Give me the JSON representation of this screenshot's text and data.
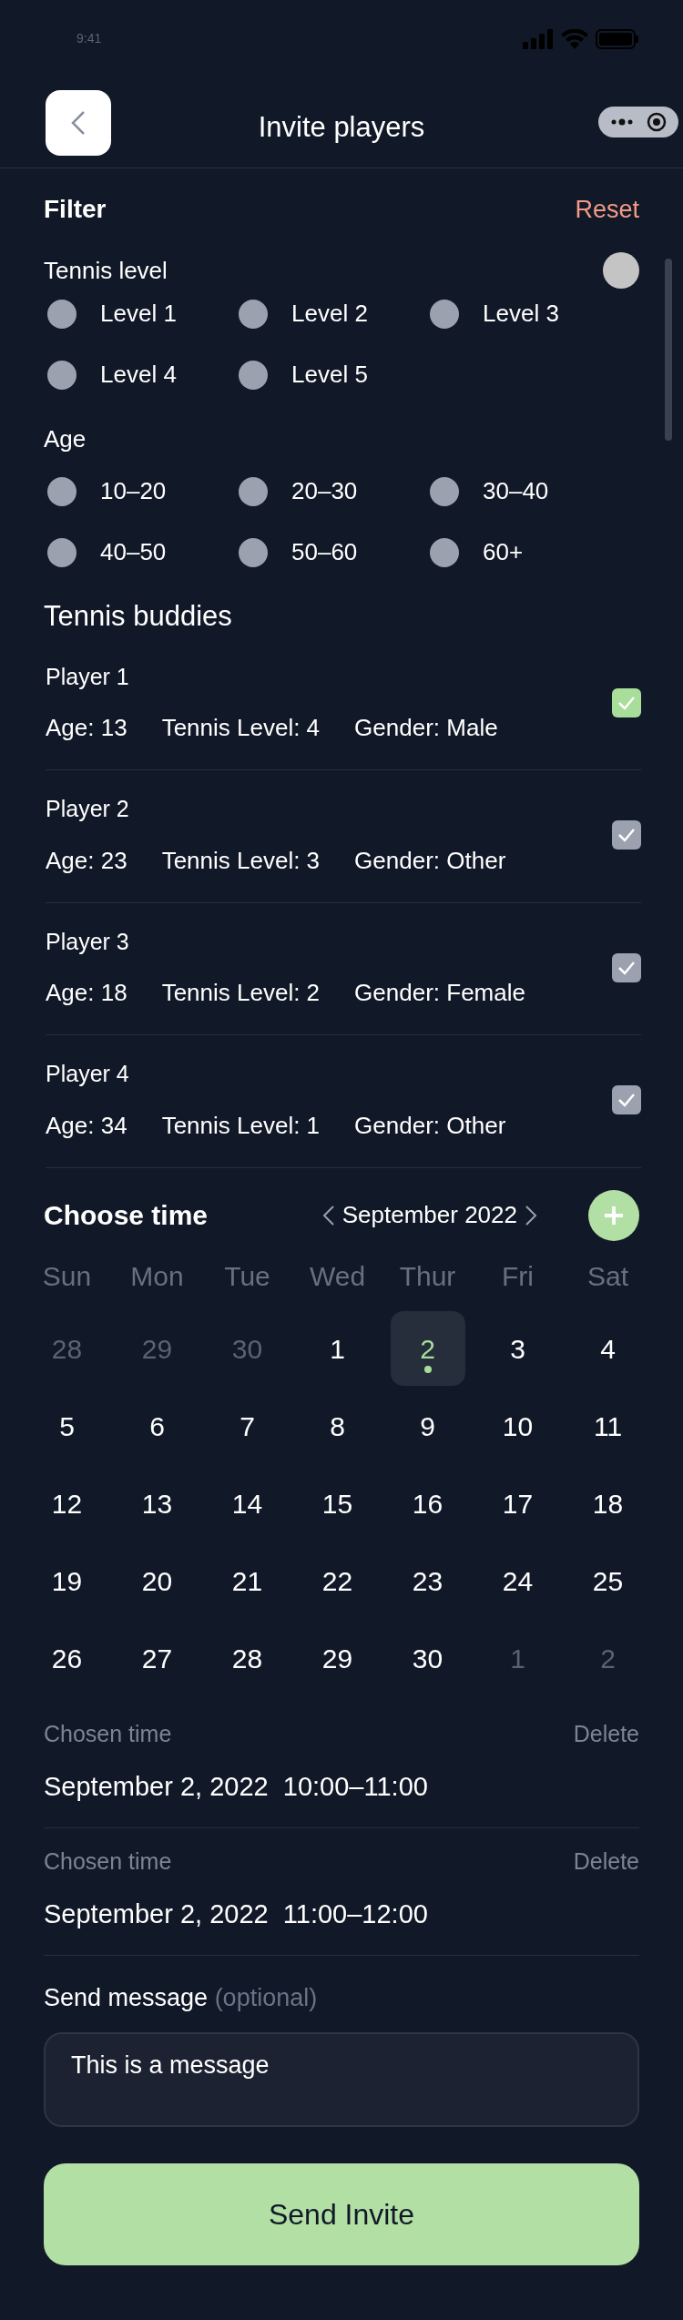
{
  "status_bar": {
    "time": "9:41"
  },
  "header": {
    "title": "Invite players"
  },
  "filter": {
    "title": "Filter",
    "reset": "Reset",
    "groups": [
      {
        "label": "Tennis level",
        "toggle": {
          "on": false
        },
        "options": [
          {
            "label": "Level 1",
            "selected": false
          },
          {
            "label": "Level 2",
            "selected": false
          },
          {
            "label": "Level 3",
            "selected": false
          },
          {
            "label": "Level 4",
            "selected": false
          },
          {
            "label": "Level 5",
            "selected": false
          }
        ]
      },
      {
        "label": "Age",
        "options": [
          {
            "label": "10–20",
            "selected": false
          },
          {
            "label": "20–30",
            "selected": false
          },
          {
            "label": "30–40",
            "selected": false
          },
          {
            "label": "40–50",
            "selected": false
          },
          {
            "label": "50–60",
            "selected": false
          },
          {
            "label": "60+",
            "selected": false
          }
        ]
      }
    ]
  },
  "buddies": {
    "title": "Tennis buddies",
    "players": [
      {
        "name": "Player 1",
        "age": "Age: 13",
        "level": "Tennis Level: 4",
        "gender": "Gender: Male",
        "selected": true
      },
      {
        "name": "Player 2",
        "age": "Age: 23",
        "level": "Tennis Level: 3",
        "gender": "Gender: Other",
        "selected": false
      },
      {
        "name": "Player 3",
        "age": "Age: 18",
        "level": "Tennis Level: 2",
        "gender": "Gender: Female",
        "selected": false
      },
      {
        "name": "Player 4",
        "age": "Age: 34",
        "level": "Tennis Level: 1",
        "gender": "Gender: Other",
        "selected": false
      }
    ]
  },
  "calendar": {
    "title": "Choose time",
    "month": "September 2022",
    "weekdays": [
      "Sun",
      "Mon",
      "Tue",
      "Wed",
      "Thur",
      "Fri",
      "Sat"
    ],
    "days": [
      {
        "label": "28",
        "muted": true,
        "selected": false,
        "has_event": false
      },
      {
        "label": "29",
        "muted": true,
        "selected": false,
        "has_event": false
      },
      {
        "label": "30",
        "muted": true,
        "selected": false,
        "has_event": false
      },
      {
        "label": "1",
        "muted": false,
        "selected": false,
        "has_event": false
      },
      {
        "label": "2",
        "muted": false,
        "selected": true,
        "has_event": true
      },
      {
        "label": "3",
        "muted": false,
        "selected": false,
        "has_event": false
      },
      {
        "label": "4",
        "muted": false,
        "selected": false,
        "has_event": false
      },
      {
        "label": "5",
        "muted": false,
        "selected": false,
        "has_event": false
      },
      {
        "label": "6",
        "muted": false,
        "selected": false,
        "has_event": false
      },
      {
        "label": "7",
        "muted": false,
        "selected": false,
        "has_event": false
      },
      {
        "label": "8",
        "muted": false,
        "selected": false,
        "has_event": false
      },
      {
        "label": "9",
        "muted": false,
        "selected": false,
        "has_event": false
      },
      {
        "label": "10",
        "muted": false,
        "selected": false,
        "has_event": false
      },
      {
        "label": "11",
        "muted": false,
        "selected": false,
        "has_event": false
      },
      {
        "label": "12",
        "muted": false,
        "selected": false,
        "has_event": false
      },
      {
        "label": "13",
        "muted": false,
        "selected": false,
        "has_event": false
      },
      {
        "label": "14",
        "muted": false,
        "selected": false,
        "has_event": false
      },
      {
        "label": "15",
        "muted": false,
        "selected": false,
        "has_event": false
      },
      {
        "label": "16",
        "muted": false,
        "selected": false,
        "has_event": false
      },
      {
        "label": "17",
        "muted": false,
        "selected": false,
        "has_event": false
      },
      {
        "label": "18",
        "muted": false,
        "selected": false,
        "has_event": false
      },
      {
        "label": "19",
        "muted": false,
        "selected": false,
        "has_event": false
      },
      {
        "label": "20",
        "muted": false,
        "selected": false,
        "has_event": false
      },
      {
        "label": "21",
        "muted": false,
        "selected": false,
        "has_event": false
      },
      {
        "label": "22",
        "muted": false,
        "selected": false,
        "has_event": false
      },
      {
        "label": "23",
        "muted": false,
        "selected": false,
        "has_event": false
      },
      {
        "label": "24",
        "muted": false,
        "selected": false,
        "has_event": false
      },
      {
        "label": "25",
        "muted": false,
        "selected": false,
        "has_event": false
      },
      {
        "label": "26",
        "muted": false,
        "selected": false,
        "has_event": false
      },
      {
        "label": "27",
        "muted": false,
        "selected": false,
        "has_event": false
      },
      {
        "label": "28",
        "muted": false,
        "selected": false,
        "has_event": false
      },
      {
        "label": "29",
        "muted": false,
        "selected": false,
        "has_event": false
      },
      {
        "label": "30",
        "muted": false,
        "selected": false,
        "has_event": false
      },
      {
        "label": "1",
        "muted": true,
        "selected": false,
        "has_event": false
      },
      {
        "label": "2",
        "muted": true,
        "selected": false,
        "has_event": false
      }
    ]
  },
  "chosen_times": [
    {
      "label": "Chosen time",
      "delete": "Delete",
      "value": "September 2, 2022  10:00–11:00"
    },
    {
      "label": "Chosen time",
      "delete": "Delete",
      "value": "September 2, 2022  11:00–12:00"
    }
  ],
  "message": {
    "label": "Send message **(optional)**",
    "value": "This is a message"
  },
  "send_button": "Send Invite"
}
